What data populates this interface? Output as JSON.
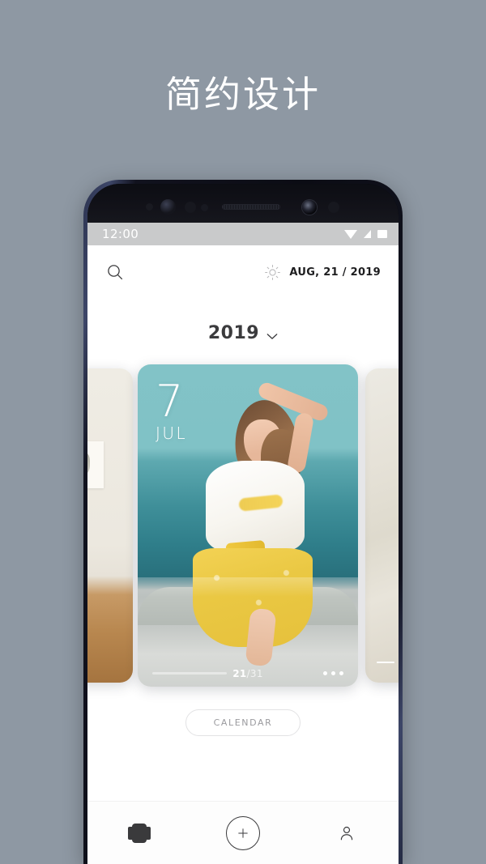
{
  "page": {
    "hero_title": "简约设计",
    "background_color": "#8e98a3"
  },
  "phone": {
    "status_bar": {
      "clock": "12:00",
      "icons": [
        "wifi-icon",
        "signal-icon",
        "battery-icon"
      ],
      "background_color": "#c9cacb"
    },
    "app_header": {
      "search_icon": "search-icon",
      "weather_icon": "sun-icon",
      "date_label": "AUG, 21 / 2019"
    },
    "year_selector": {
      "label": "2019",
      "chevron_icon": "chevron-down-icon"
    },
    "carousel": {
      "cards": [
        {
          "position": "left-peek",
          "art": "beige interior room with framed picture and wooden floor"
        },
        {
          "position": "center",
          "day": "7",
          "month": "JUL",
          "art": "woman in white top and yellow skirt by turquoise sea",
          "page_current": "21",
          "page_separator": "/",
          "page_total": "31",
          "progress_percent": 68,
          "more_icon": "more-dots-icon",
          "accent_color": "#79bfc4"
        },
        {
          "position": "right-peek",
          "art": "cream fabric texture"
        }
      ]
    },
    "calendar_button": {
      "label": "CALENDAR"
    },
    "bottom_nav": {
      "items": [
        {
          "icon": "cards-carousel-icon",
          "active": true
        },
        {
          "icon": "plus-icon",
          "active": false
        },
        {
          "icon": "person-icon",
          "active": false
        }
      ]
    }
  }
}
